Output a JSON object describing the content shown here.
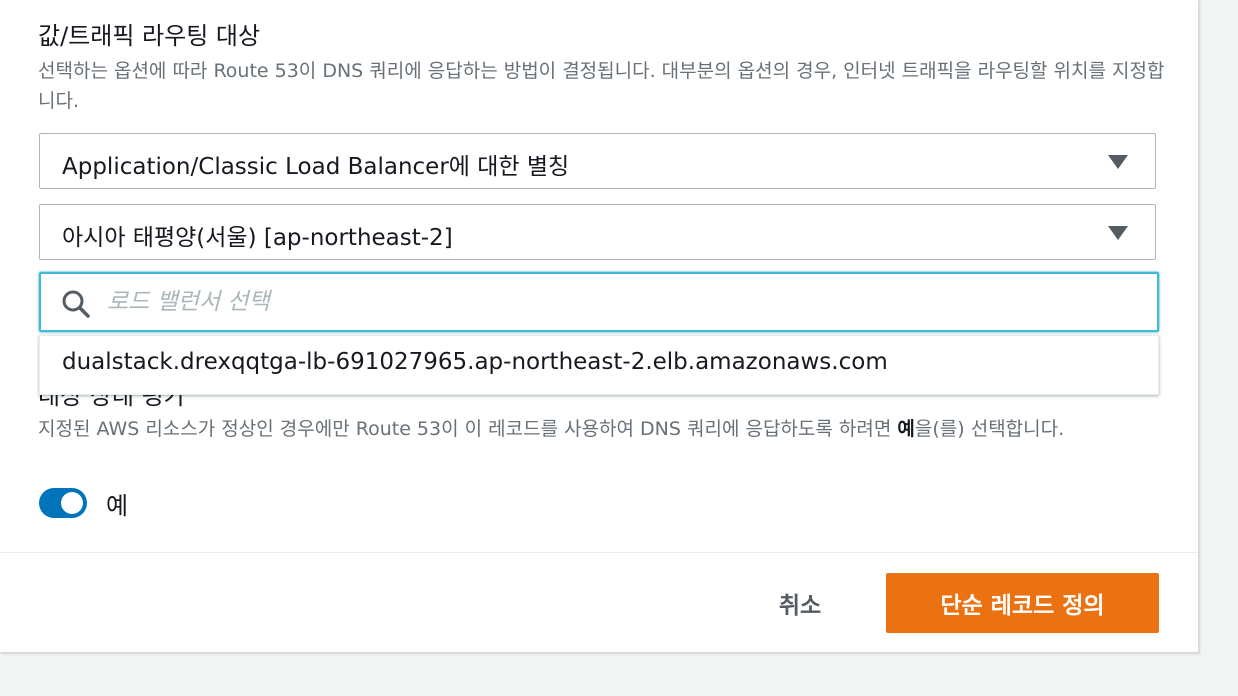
{
  "routing_target": {
    "title": "값/트래픽 라우팅 대상",
    "description": "선택하는 옵션에 따라 Route 53이 DNS 쿼리에 응답하는 방법이 결정됩니다. 대부분의 옵션의 경우, 인터넷 트래픽을 라우팅할 위치를 지정합니다.",
    "endpoint_type_value": "Application/Classic Load Balancer에 대한 별칭",
    "region_value": "아시아 태평양(서울) [ap-northeast-2]",
    "search": {
      "placeholder": "로드 밸런서 선택",
      "value": ""
    },
    "dropdown_options": [
      "dualstack.drexqqtga-lb-691027965.ap-northeast-2.elb.amazonaws.com"
    ]
  },
  "health": {
    "label": "대상 상태 평가",
    "description_before": "지정된 AWS 리소스가 정상인 경우에만 Route 53이 이 레코드를 사용하여 DNS 쿼리에 응답하도록 하려면 ",
    "description_bold": "예",
    "description_after": "을(를) 선택합니다.",
    "toggle_label": "예",
    "toggle_on": true
  },
  "footer": {
    "cancel_label": "취소",
    "submit_label": "단순 레코드 정의"
  },
  "icons": {
    "search": "search-icon",
    "caret": "caret-down-icon"
  },
  "colors": {
    "accent_orange": "#ec7211",
    "toggle_blue": "#0073bb",
    "focus_border": "#44b9d6"
  }
}
